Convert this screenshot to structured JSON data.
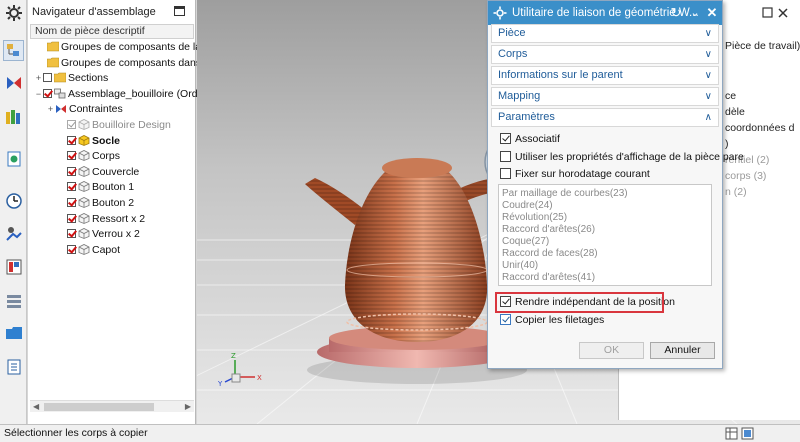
{
  "navigator": {
    "title": "Navigateur d'assemblage",
    "column_header": "Nom de pièce descriptif",
    "rows": [
      {
        "label": "Groupes de composants de la s",
        "expand": "",
        "check": "none",
        "icon": "folder",
        "style": ""
      },
      {
        "label": "Groupes de composants dans l",
        "expand": "",
        "check": "none",
        "icon": "folder",
        "style": ""
      },
      {
        "label": "Sections",
        "expand": "+",
        "check": "empty",
        "icon": "folder",
        "style": ""
      },
      {
        "label": "Assemblage_bouilloire (Ord",
        "expand": "−",
        "check": "on",
        "icon": "assembly",
        "style": ""
      },
      {
        "label": "Contraintes",
        "expand": "+",
        "check": "none",
        "icon": "constraints",
        "style": ""
      },
      {
        "label": "Bouilloire Design",
        "expand": "",
        "check": "gray",
        "icon": "part-gray",
        "style": "grey"
      },
      {
        "label": "Socle",
        "expand": "",
        "check": "on",
        "icon": "part-yellow",
        "style": "bold"
      },
      {
        "label": "Corps",
        "expand": "",
        "check": "on",
        "icon": "part",
        "style": ""
      },
      {
        "label": "Couvercle",
        "expand": "",
        "check": "on",
        "icon": "part",
        "style": ""
      },
      {
        "label": "Bouton 1",
        "expand": "",
        "check": "on",
        "icon": "part",
        "style": ""
      },
      {
        "label": "Bouton 2",
        "expand": "",
        "check": "on",
        "icon": "part",
        "style": ""
      },
      {
        "label": "Ressort x 2",
        "expand": "",
        "check": "on",
        "icon": "part",
        "style": ""
      },
      {
        "label": "Verrou x 2",
        "expand": "",
        "check": "on",
        "icon": "part",
        "style": ""
      },
      {
        "label": "Capot",
        "expand": "",
        "check": "on",
        "icon": "part",
        "style": ""
      }
    ]
  },
  "dialog": {
    "title": "Utilitaire de liaison de géométrie W...",
    "sections": {
      "piece": "Pièce",
      "corps": "Corps",
      "parent_info": "Informations sur le parent",
      "mapping": "Mapping",
      "parametres": "Paramètres"
    },
    "options": {
      "associatif": "Associatif",
      "display_props": "Utiliser les propriétés d'affichage de la pièce pare",
      "timestamp": "Fixer sur horodatage courant",
      "independent": "Rendre indépendant de la position",
      "copy_threads": "Copier les filetages"
    },
    "history": [
      "Par maillage de courbes(23)",
      "Coudre(24)",
      "Révolution(25)",
      "Raccord d'arêtes(26)",
      "Coque(27)",
      "Raccord de faces(28)",
      "Unir(40)",
      "Raccord d'arêtes(41)"
    ],
    "ok_label": "OK",
    "cancel_label": "Annuler"
  },
  "right_panel": {
    "lines": [
      {
        "text": "Pièce de travail)",
        "style": ""
      },
      {
        "text": "ce",
        "style": ""
      },
      {
        "text": "dèle",
        "style": ""
      },
      {
        "text": "coordonnées d",
        "style": ""
      },
      {
        "text": ")",
        "style": ""
      },
      {
        "text": "rentiel (2)",
        "style": "g"
      },
      {
        "text": "corps (3)",
        "style": "g"
      },
      {
        "text": "n (2)",
        "style": "g"
      }
    ]
  },
  "status": {
    "text": "Sélectionner les corps à copier"
  },
  "colors": {
    "title_bar": "#3b8fc9",
    "section_text": "#1f5c99",
    "highlight": "#d9363e",
    "kettle_body": "#b8603f",
    "check_red": "#d01010"
  }
}
